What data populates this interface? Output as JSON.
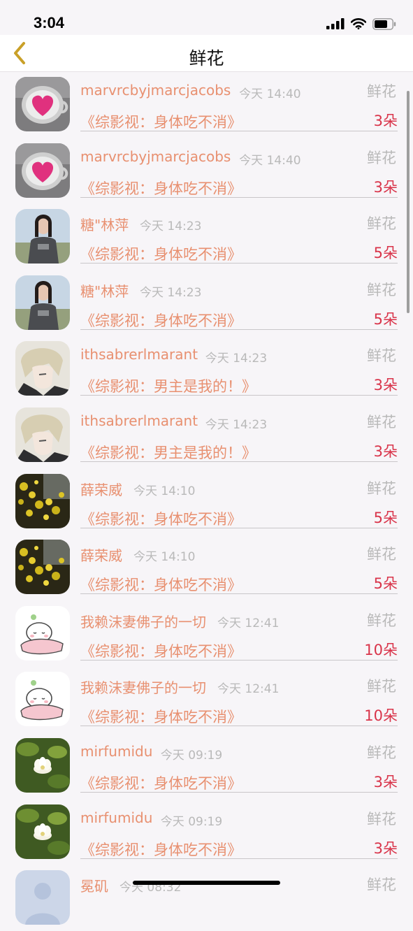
{
  "status": {
    "time": "3:04"
  },
  "nav": {
    "title": "鲜花"
  },
  "colors": {
    "name": "#e89070",
    "count": "#d9344a",
    "muted": "#b9b9b9",
    "back": "#c9a028"
  },
  "records": [
    {
      "name": "marvrcbyjmarcjacobs",
      "time": "今天 14:40",
      "gift": "鲜花",
      "book": "《综影视：身体吃不消》",
      "count": "3朵",
      "avatar": "heart-latte-avatar"
    },
    {
      "name": "marvrcbyjmarcjacobs",
      "time": "今天 14:40",
      "gift": "鲜花",
      "book": "《综影视：身体吃不消》",
      "count": "3朵",
      "avatar": "heart-latte-avatar"
    },
    {
      "name": "糖\"林萍",
      "time": "今天 14:23",
      "gift": "鲜花",
      "book": "《综影视：身体吃不消》",
      "count": "5朵",
      "avatar": "girl-photo-avatar"
    },
    {
      "name": "糖\"林萍",
      "time": "今天 14:23",
      "gift": "鲜花",
      "book": "《综影视：身体吃不消》",
      "count": "5朵",
      "avatar": "girl-photo-avatar"
    },
    {
      "name": "ithsabrerlmarant",
      "time": "今天 14:23",
      "gift": "鲜花",
      "book": "《综影视：男主是我的！》",
      "count": "3朵",
      "avatar": "anime-boy-avatar"
    },
    {
      "name": "ithsabrerlmarant",
      "time": "今天 14:23",
      "gift": "鲜花",
      "book": "《综影视：男主是我的！》",
      "count": "3朵",
      "avatar": "anime-boy-avatar"
    },
    {
      "name": "薛荣威",
      "time": "今天 14:10",
      "gift": "鲜花",
      "book": "《综影视：身体吃不消》",
      "count": "5朵",
      "avatar": "yellow-flowers-avatar"
    },
    {
      "name": "薛荣威",
      "time": "今天 14:10",
      "gift": "鲜花",
      "book": "《综影视：身体吃不消》",
      "count": "5朵",
      "avatar": "yellow-flowers-avatar"
    },
    {
      "name": "我赖沫妻佛子的一切",
      "time": "今天 12:41",
      "gift": "鲜花",
      "book": "《综影视：身体吃不消》",
      "count": "10朵",
      "avatar": "sleeping-bear-avatar"
    },
    {
      "name": "我赖沫妻佛子的一切",
      "time": "今天 12:41",
      "gift": "鲜花",
      "book": "《综影视：身体吃不消》",
      "count": "10朵",
      "avatar": "sleeping-bear-avatar"
    },
    {
      "name": "mirfumidu",
      "time": "今天 09:19",
      "gift": "鲜花",
      "book": "《综影视：身体吃不消》",
      "count": "3朵",
      "avatar": "white-flower-avatar"
    },
    {
      "name": "mirfumidu",
      "time": "今天 09:19",
      "gift": "鲜花",
      "book": "《综影视：身体吃不消》",
      "count": "3朵",
      "avatar": "white-flower-avatar"
    },
    {
      "name": "冕矶",
      "time": "今天 08:32",
      "gift": "鲜花",
      "book": "",
      "count": "",
      "avatar": "default-avatar"
    }
  ]
}
